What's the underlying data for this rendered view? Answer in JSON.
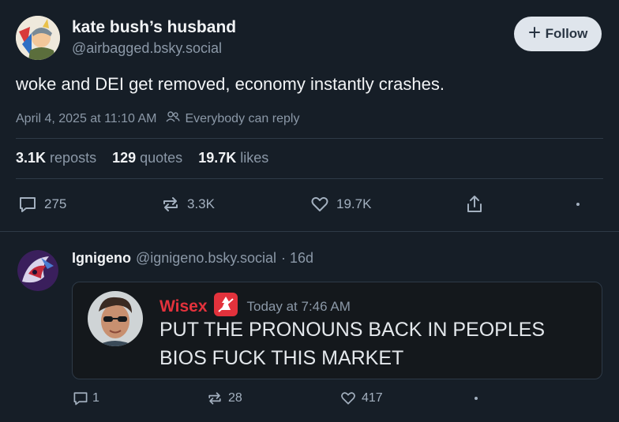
{
  "post": {
    "display_name": "kate bush’s husband",
    "handle": "@airbagged.bsky.social",
    "follow_label": "Follow",
    "text": "woke and DEI get removed, economy instantly crashes.",
    "timestamp": "April 4, 2025 at 11:10 AM",
    "reply_setting": "Everybody can reply",
    "stats": {
      "reposts_count": "3.1K",
      "reposts_label": "reposts",
      "quotes_count": "129",
      "quotes_label": "quotes",
      "likes_count": "19.7K",
      "likes_label": "likes"
    },
    "actions": {
      "replies": "275",
      "reposts": "3.3K",
      "likes": "19.7K"
    }
  },
  "reply": {
    "display_name": "Ignigeno",
    "handle": "@ignigeno.bsky.social",
    "age": "· 16d",
    "embed": {
      "author": "Wisex",
      "time": "Today at 7:46 AM",
      "line1": "PUT THE PRONOUNS BACK IN PEOPLES",
      "line2": "BIOS FUCK THIS MARKET"
    },
    "actions": {
      "replies": "1",
      "reposts": "28",
      "likes": "417"
    }
  },
  "colors": {
    "background": "#161e27",
    "accent_red": "#e3323c",
    "follow_bg": "#dfe5ec"
  },
  "icons": [
    "plus-icon",
    "people-icon",
    "reply-icon",
    "repost-icon",
    "heart-icon",
    "share-icon",
    "more-icon",
    "app-badge-icon"
  ]
}
